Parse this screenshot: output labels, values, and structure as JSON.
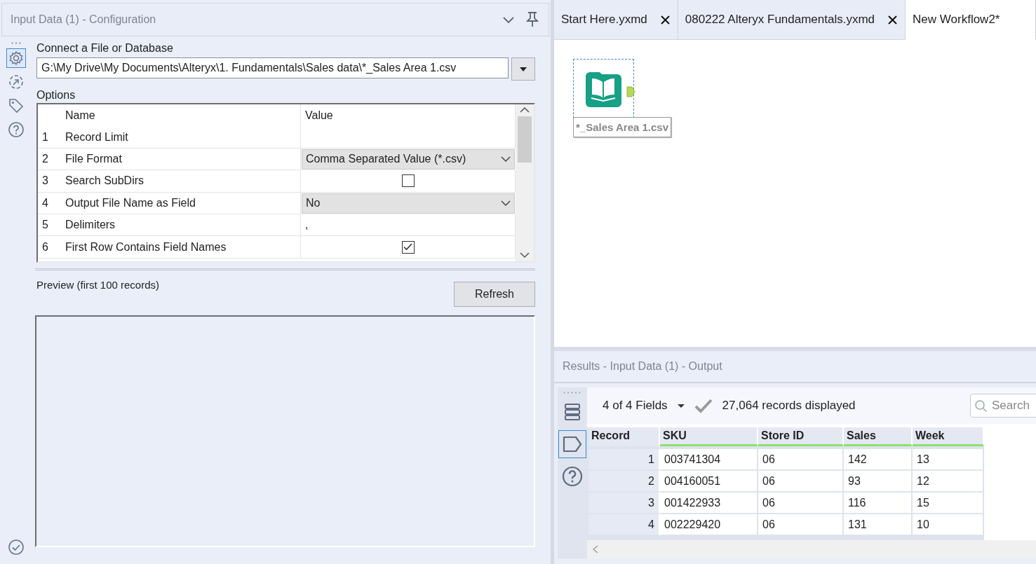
{
  "config_panel": {
    "title": "Input Data (1) - Configuration",
    "side_tabs": [
      {
        "kind": "settings",
        "selected": true
      },
      {
        "kind": "anchor",
        "selected": false
      },
      {
        "kind": "tag",
        "selected": false
      },
      {
        "kind": "help",
        "selected": false
      }
    ],
    "connect_label": "Connect a File or Database",
    "file_path": "G:\\My Drive\\My Documents\\Alteryx\\1. Fundamentals\\Sales data\\*_Sales Area 1.csv",
    "options_label": "Options",
    "options_table": {
      "columns": [
        "Name",
        "Value"
      ],
      "rows": [
        {
          "number": "1",
          "name": "Record Limit",
          "kind": "text",
          "value": ""
        },
        {
          "number": "2",
          "name": "File Format",
          "kind": "dropdown",
          "value": "Comma Separated Value (*.csv)"
        },
        {
          "number": "3",
          "name": "Search SubDirs",
          "kind": "checkbox",
          "checked": false
        },
        {
          "number": "4",
          "name": "Output File Name as Field",
          "kind": "dropdown",
          "value": "No"
        },
        {
          "number": "5",
          "name": "Delimiters",
          "kind": "text",
          "value": ","
        },
        {
          "number": "6",
          "name": "First Row Contains Field Names",
          "kind": "checkbox",
          "checked": true
        }
      ]
    },
    "preview_label": "Preview (first 100 records)",
    "refresh_button": "Refresh"
  },
  "workflow_tabs": [
    {
      "label": "Start Here.yxmd",
      "selected": false,
      "closable": true
    },
    {
      "label": "080222 Alteryx Fundamentals.yxmd",
      "selected": false,
      "closable": true
    },
    {
      "label": "New Workflow2*",
      "selected": true,
      "closable": false
    }
  ],
  "canvas": {
    "tool": {
      "label": "*_Sales Area 1.csv",
      "selected": true
    }
  },
  "results": {
    "title": "Results - Input Data (1) - Output",
    "side_tabs": [
      {
        "kind": "list",
        "selected": false
      },
      {
        "kind": "tag",
        "selected": true
      },
      {
        "kind": "help",
        "selected": false
      }
    ],
    "fields_dropdown": "4 of 4 Fields",
    "records_text": "27,064 records displayed",
    "search": {
      "placeholder": "Search"
    },
    "table": {
      "columns": [
        "Record",
        "SKU",
        "Store ID",
        "Sales",
        "Week"
      ],
      "rows": [
        [
          "1",
          "003741304",
          "06",
          "142",
          "13"
        ],
        [
          "2",
          "004160051",
          "06",
          "93",
          "12"
        ],
        [
          "3",
          "001422933",
          "06",
          "116",
          "15"
        ],
        [
          "4",
          "002229420",
          "06",
          "131",
          "10"
        ]
      ]
    }
  }
}
